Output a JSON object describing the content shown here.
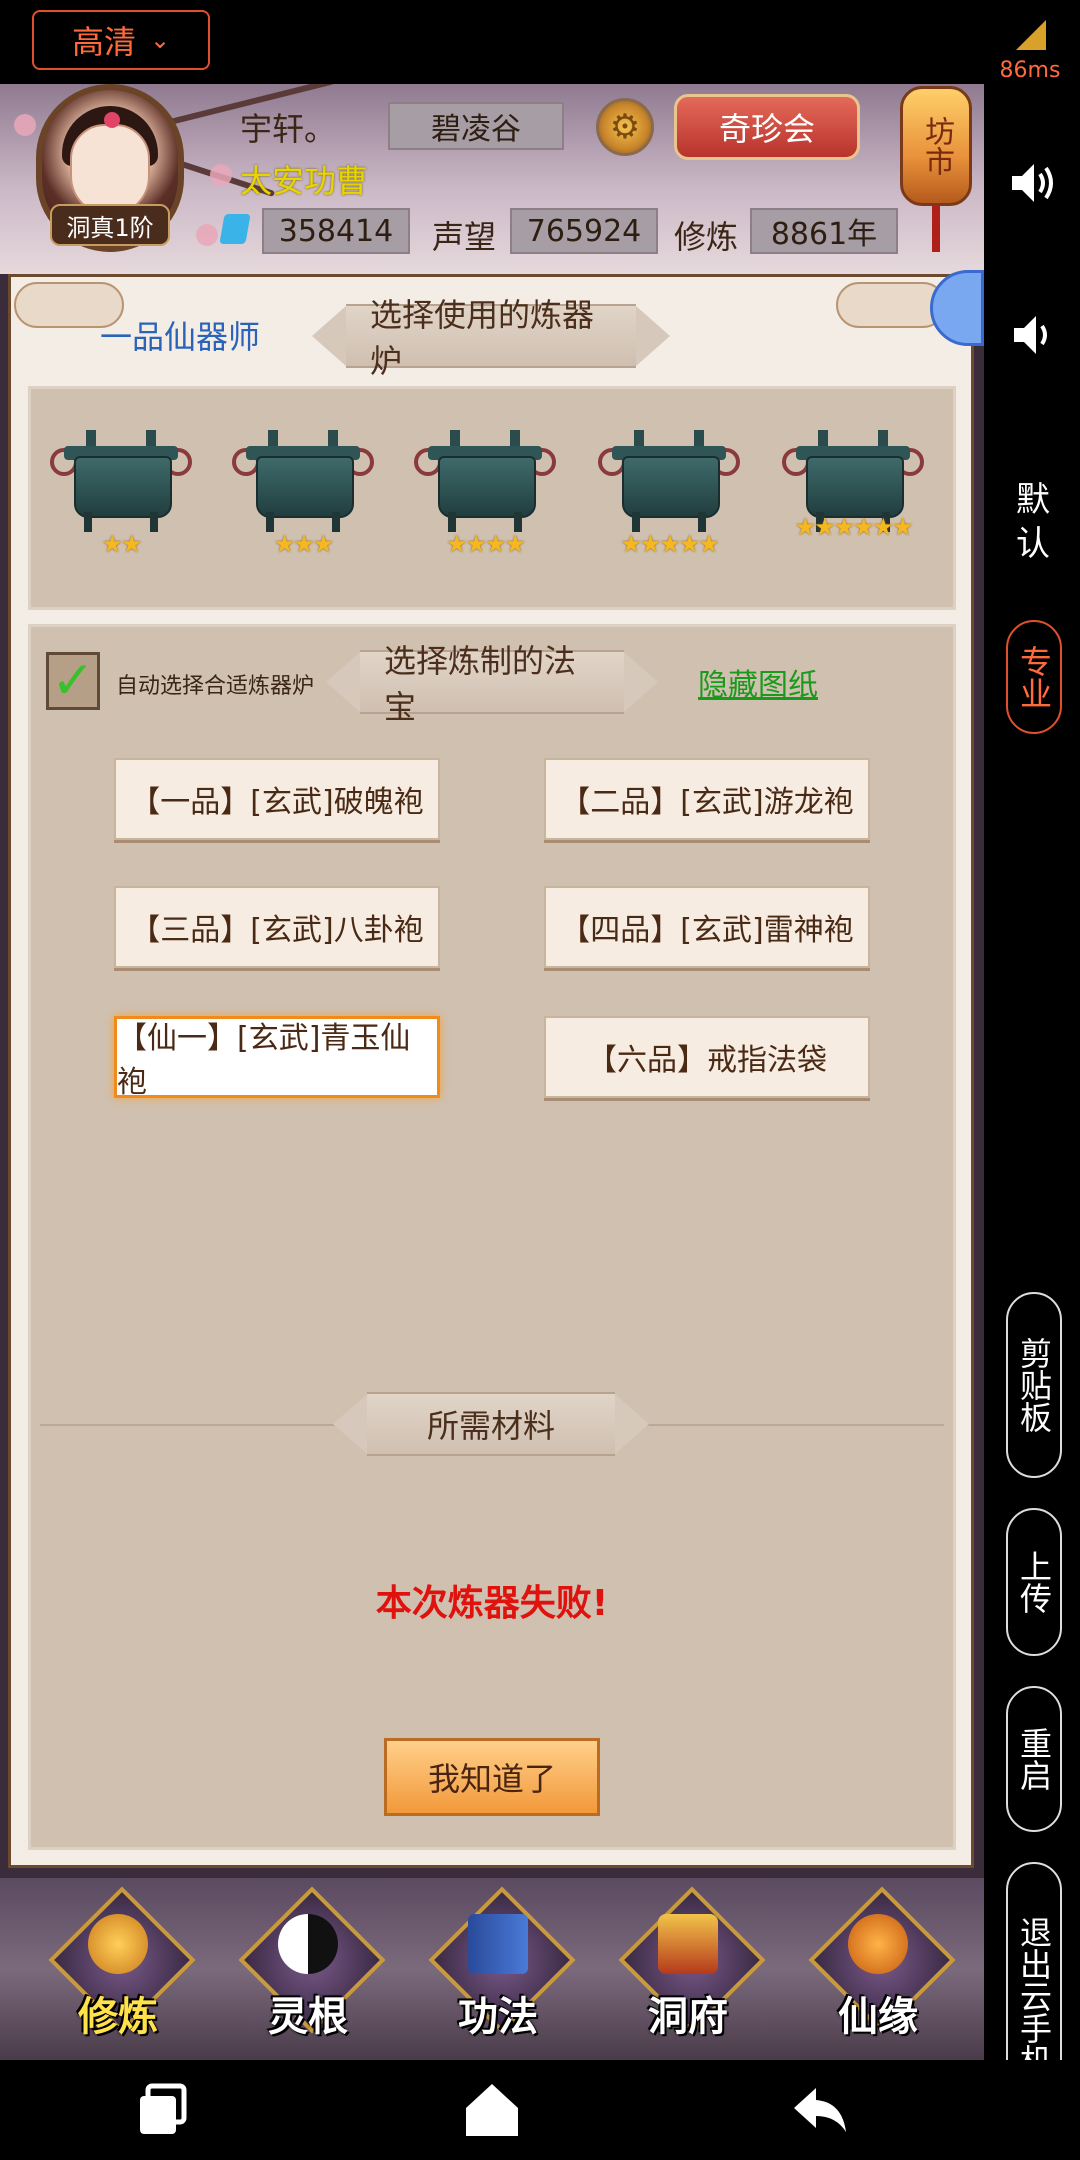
{
  "status_bar": {
    "quality": "高清",
    "latency": "86ms"
  },
  "side_panel": {
    "mode_default": "默认",
    "mode_pro": "专业",
    "clipboard": "剪贴板",
    "upload": "上传",
    "restart": "重启",
    "exit": "退出云手机"
  },
  "header": {
    "player_name": "宇轩。",
    "player_title": "太安功曹",
    "location": "碧凌谷",
    "treasure_button": "奇珍会",
    "market_label": "坊市",
    "rank": "洞真1阶",
    "spirit_stones": "358414",
    "reputation_label": "声望",
    "reputation": "765924",
    "cultivation_label": "修炼",
    "cultivation_years": "8861年"
  },
  "panel": {
    "class_label": "一品仙器师",
    "furnace_title": "选择使用的炼器炉",
    "furnaces": [
      {
        "stars": "★★"
      },
      {
        "stars": "★★★"
      },
      {
        "stars": "★★★★"
      },
      {
        "stars": "★★★★★"
      },
      {
        "stars": "★★★★★★"
      }
    ],
    "auto_select_label": "自动选择合适炼器炉",
    "recipe_title": "选择炼制的法宝",
    "hide_link": "隐藏图纸",
    "recipes": [
      "【一品】[玄武]破魄袍",
      "【二品】[玄武]游龙袍",
      "【三品】[玄武]八卦袍",
      "【四品】[玄武]雷神袍",
      "【仙一】[玄武]青玉仙袍",
      "【六品】戒指法袋"
    ],
    "materials_title": "所需材料",
    "fail_message": "本次炼器失败!",
    "ok_button": "我知道了"
  },
  "game_nav": {
    "items": [
      "修炼",
      "灵根",
      "功法",
      "洞府",
      "仙缘"
    ]
  }
}
